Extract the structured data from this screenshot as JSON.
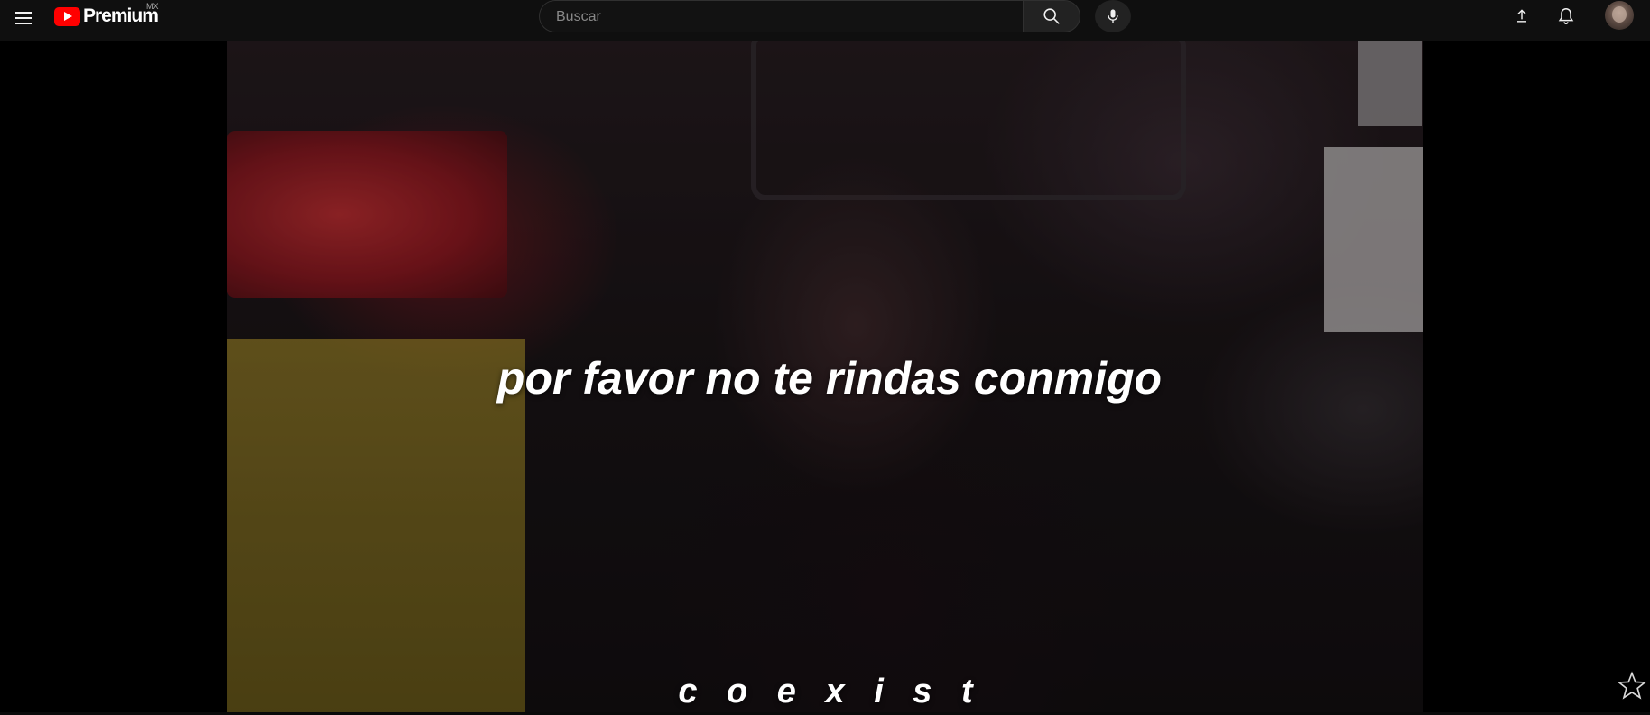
{
  "header": {
    "logo_text": "Premium",
    "logo_country": "MX",
    "search_placeholder": "Buscar",
    "icons": {
      "menu": "hamburger-menu-icon",
      "search": "search-icon",
      "mic": "microphone-icon",
      "upload": "upload-icon",
      "notifications": "bell-icon"
    }
  },
  "video": {
    "caption": "por favor no te rindas conmigo",
    "channel_name": "c o e x i s t"
  },
  "overlay": {
    "star_icon": "star-outline-icon"
  },
  "colors": {
    "topbar": "#0f0f0f",
    "brand_red": "#ff0000",
    "text_primary": "#ffffff"
  }
}
